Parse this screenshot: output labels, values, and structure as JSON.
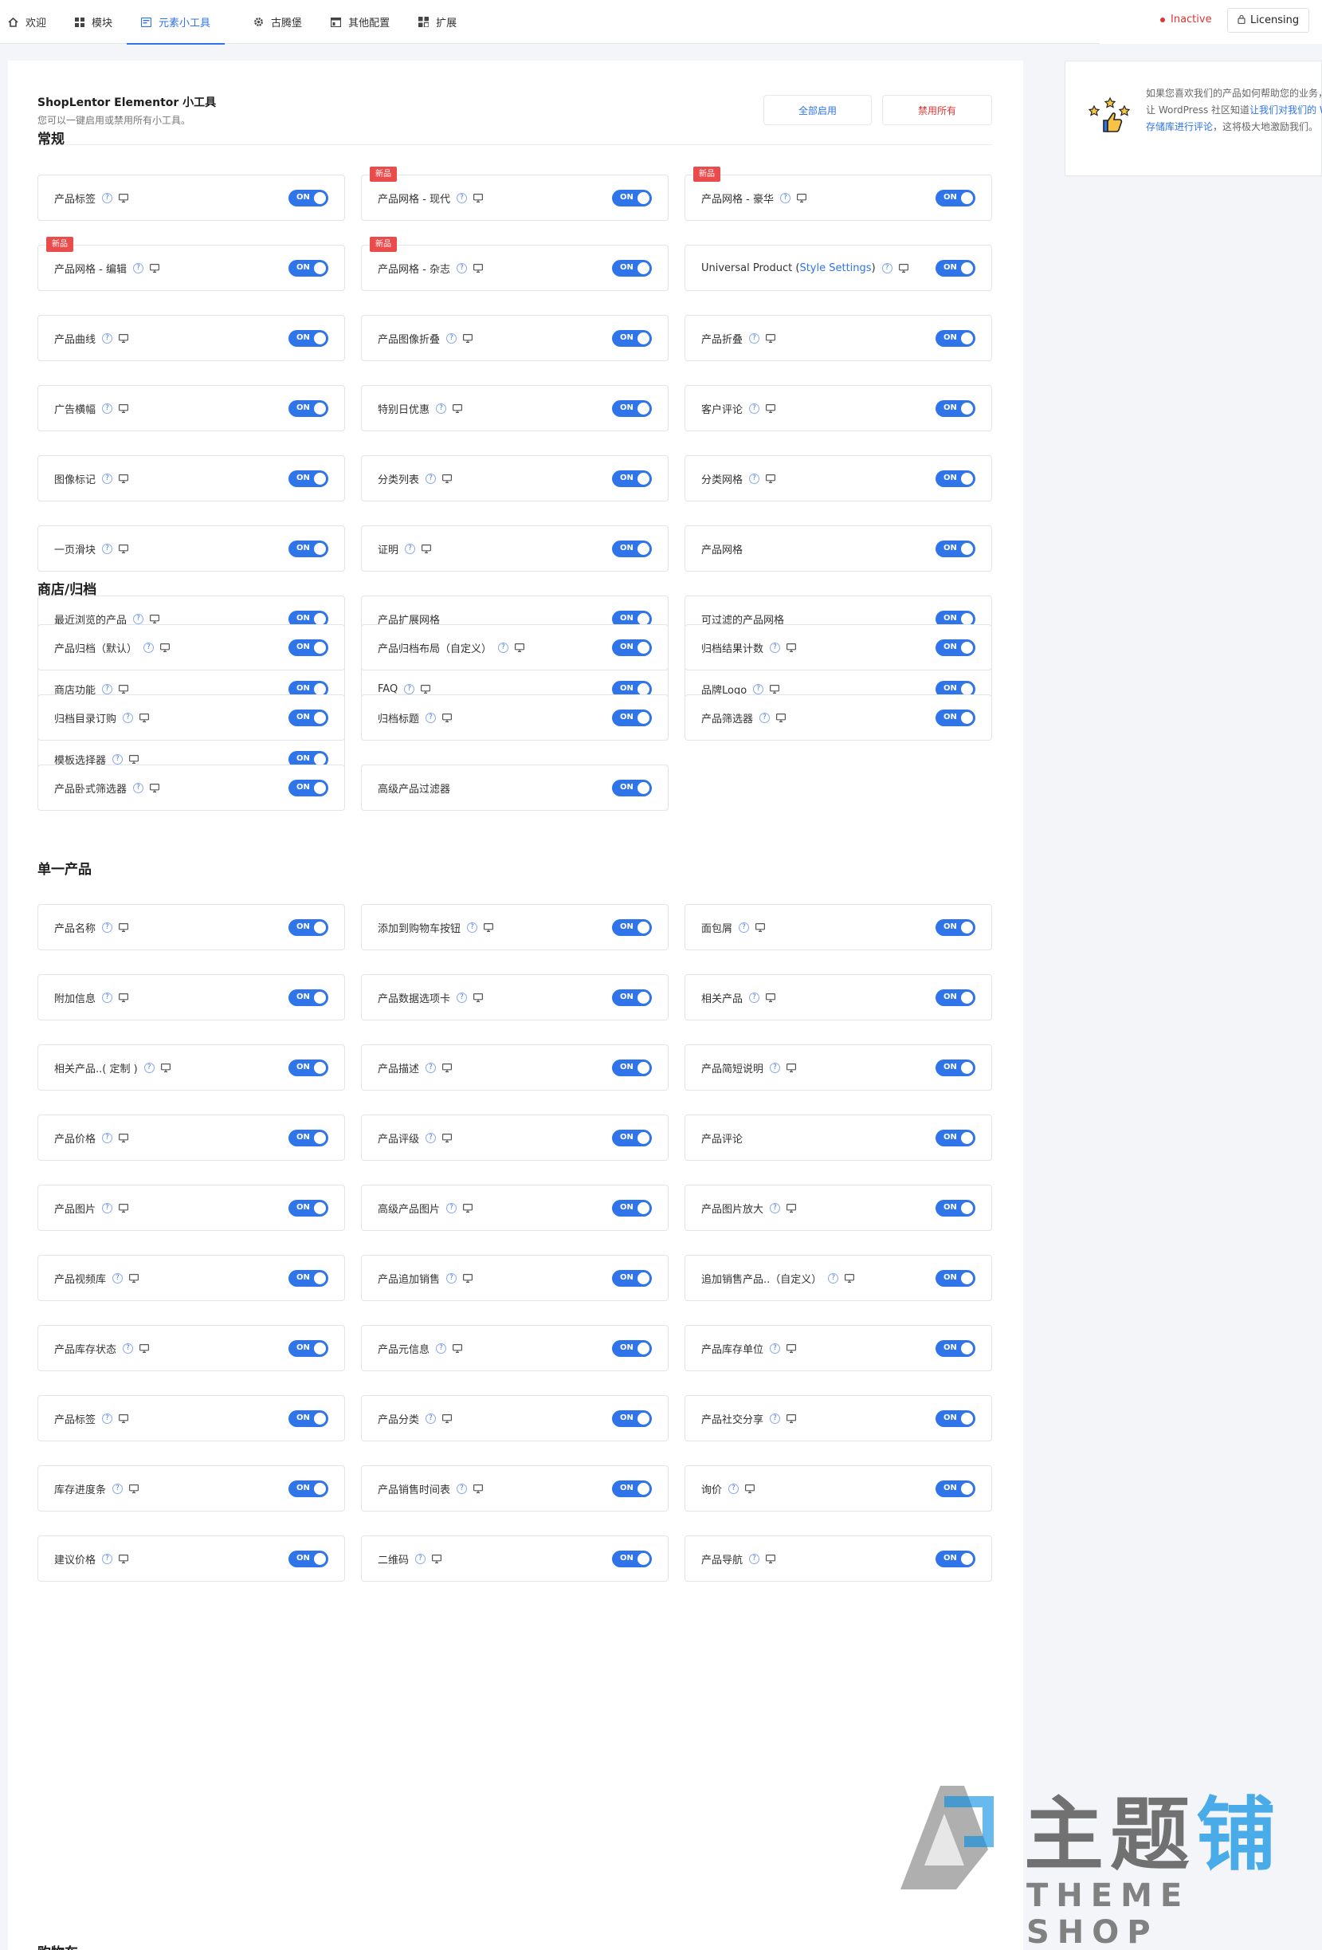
{
  "nav": {
    "tabs": [
      {
        "label": "欢迎",
        "icon": "home-icon"
      },
      {
        "label": "模块",
        "icon": "grid-icon"
      },
      {
        "label": "元素小工具",
        "icon": "widget-icon",
        "active": true
      },
      {
        "label": "古腾堡",
        "icon": "gear-icon"
      },
      {
        "label": "其他配置",
        "icon": "settings-panel-icon"
      },
      {
        "label": "扩展",
        "icon": "extension-icon"
      }
    ],
    "status": "Inactive",
    "licensing": "Licensing"
  },
  "panel": {
    "title": "ShopLentor Elementor 小工具",
    "subtitle": "您可以一键启用或禁用所有小工具。",
    "enable_all": "全部启用",
    "disable_all": "禁用所有"
  },
  "toggle_label": "ON",
  "badge_label": "新品",
  "sections": [
    {
      "title": "常规",
      "items": [
        {
          "label": "产品标签",
          "help": true,
          "preview": true
        },
        {
          "label": "产品网格 - 现代",
          "help": true,
          "preview": true,
          "badge": true
        },
        {
          "label": "产品网格 - 豪华",
          "help": true,
          "preview": true,
          "badge": true
        },
        {
          "label": "产品网格 - 编辑",
          "help": true,
          "preview": true,
          "badge": true
        },
        {
          "label": "产品网格 - 杂志",
          "help": true,
          "preview": true,
          "badge": true
        },
        {
          "label": "Universal Product (",
          "link": "Style Settings",
          "suffix": ")",
          "help": true,
          "preview": true
        },
        {
          "label": "产品曲线",
          "help": true,
          "preview": true
        },
        {
          "label": "产品图像折叠",
          "help": true,
          "preview": true
        },
        {
          "label": "产品折叠",
          "help": true,
          "preview": true
        },
        {
          "label": "广告横幅",
          "help": true,
          "preview": true
        },
        {
          "label": "特别日优惠",
          "help": true,
          "preview": true
        },
        {
          "label": "客户评论",
          "help": true,
          "preview": true
        },
        {
          "label": "图像标记",
          "help": true,
          "preview": true
        },
        {
          "label": "分类列表",
          "help": true,
          "preview": true
        },
        {
          "label": "分类网格",
          "help": true,
          "preview": true
        },
        {
          "label": "一页滑块",
          "help": true,
          "preview": true
        },
        {
          "label": "证明",
          "help": true,
          "preview": true
        },
        {
          "label": "产品网格",
          "help": false,
          "preview": false
        },
        {
          "label": "最近浏览的产品",
          "help": true,
          "preview": true
        },
        {
          "label": "产品扩展网格",
          "help": false,
          "preview": false
        },
        {
          "label": "可过滤的产品网格",
          "help": false,
          "preview": false
        },
        {
          "label": "商店功能",
          "help": true,
          "preview": true
        },
        {
          "label": "FAQ",
          "help": true,
          "preview": true
        },
        {
          "label": "品牌Logo",
          "help": true,
          "preview": true
        },
        {
          "label": "模板选择器",
          "help": true,
          "preview": true
        }
      ]
    },
    {
      "title": "商店/归档",
      "items": [
        {
          "label": "产品归档（默认）",
          "help": true,
          "preview": true
        },
        {
          "label": "产品归档布局（自定义）",
          "help": true,
          "preview": true
        },
        {
          "label": "归档结果计数",
          "help": true,
          "preview": true
        },
        {
          "label": "归档目录订购",
          "help": true,
          "preview": true
        },
        {
          "label": "归档标题",
          "help": true,
          "preview": true
        },
        {
          "label": "产品筛选器",
          "help": true,
          "preview": true
        },
        {
          "label": "产品卧式筛选器",
          "help": true,
          "preview": true
        },
        {
          "label": "高级产品过滤器",
          "help": false,
          "preview": false
        }
      ]
    },
    {
      "title": "单一产品",
      "items": [
        {
          "label": "产品名称",
          "help": true,
          "preview": true
        },
        {
          "label": "添加到购物车按钮",
          "help": true,
          "preview": true
        },
        {
          "label": "面包屑",
          "help": true,
          "preview": true
        },
        {
          "label": "附加信息",
          "help": true,
          "preview": true
        },
        {
          "label": "产品数据选项卡",
          "help": true,
          "preview": true
        },
        {
          "label": "相关产品",
          "help": true,
          "preview": true
        },
        {
          "label": "相关产品..( 定制 )",
          "help": true,
          "preview": true
        },
        {
          "label": "产品描述",
          "help": true,
          "preview": true
        },
        {
          "label": "产品简短说明",
          "help": true,
          "preview": true
        },
        {
          "label": "产品价格",
          "help": true,
          "preview": true
        },
        {
          "label": "产品评级",
          "help": true,
          "preview": true
        },
        {
          "label": "产品评论",
          "help": false,
          "preview": false
        },
        {
          "label": "产品图片",
          "help": true,
          "preview": true
        },
        {
          "label": "高级产品图片",
          "help": true,
          "preview": true
        },
        {
          "label": "产品图片放大",
          "help": true,
          "preview": true
        },
        {
          "label": "产品视频库",
          "help": true,
          "preview": true
        },
        {
          "label": "产品追加销售",
          "help": true,
          "preview": true
        },
        {
          "label": "追加销售产品..（自定义）",
          "help": true,
          "preview": true
        },
        {
          "label": "产品库存状态",
          "help": true,
          "preview": true
        },
        {
          "label": "产品元信息",
          "help": true,
          "preview": true
        },
        {
          "label": "产品库存单位",
          "help": true,
          "preview": true
        },
        {
          "label": "产品标签",
          "help": true,
          "preview": true
        },
        {
          "label": "产品分类",
          "help": true,
          "preview": true
        },
        {
          "label": "产品社交分享",
          "help": true,
          "preview": true
        },
        {
          "label": "库存进度条",
          "help": true,
          "preview": true
        },
        {
          "label": "产品销售时间表",
          "help": true,
          "preview": true
        },
        {
          "label": "询价",
          "help": true,
          "preview": true
        },
        {
          "label": "建议价格",
          "help": true,
          "preview": true
        },
        {
          "label": "二维码",
          "help": true,
          "preview": true
        },
        {
          "label": "产品导航",
          "help": true,
          "preview": true
        }
      ]
    },
    {
      "title": "购物车",
      "items": []
    }
  ],
  "side": {
    "text_before": "如果您喜欢我们的产品如何帮助您的业务，请让 WordPress 社区知道",
    "link": "让我们对我们的 WP 存储库进行评论",
    "text_after": "，这将极大地激励我们。"
  },
  "watermark": {
    "text_main": "主题",
    "text_accent": "铺",
    "text_sub": "THEME SHOP"
  }
}
